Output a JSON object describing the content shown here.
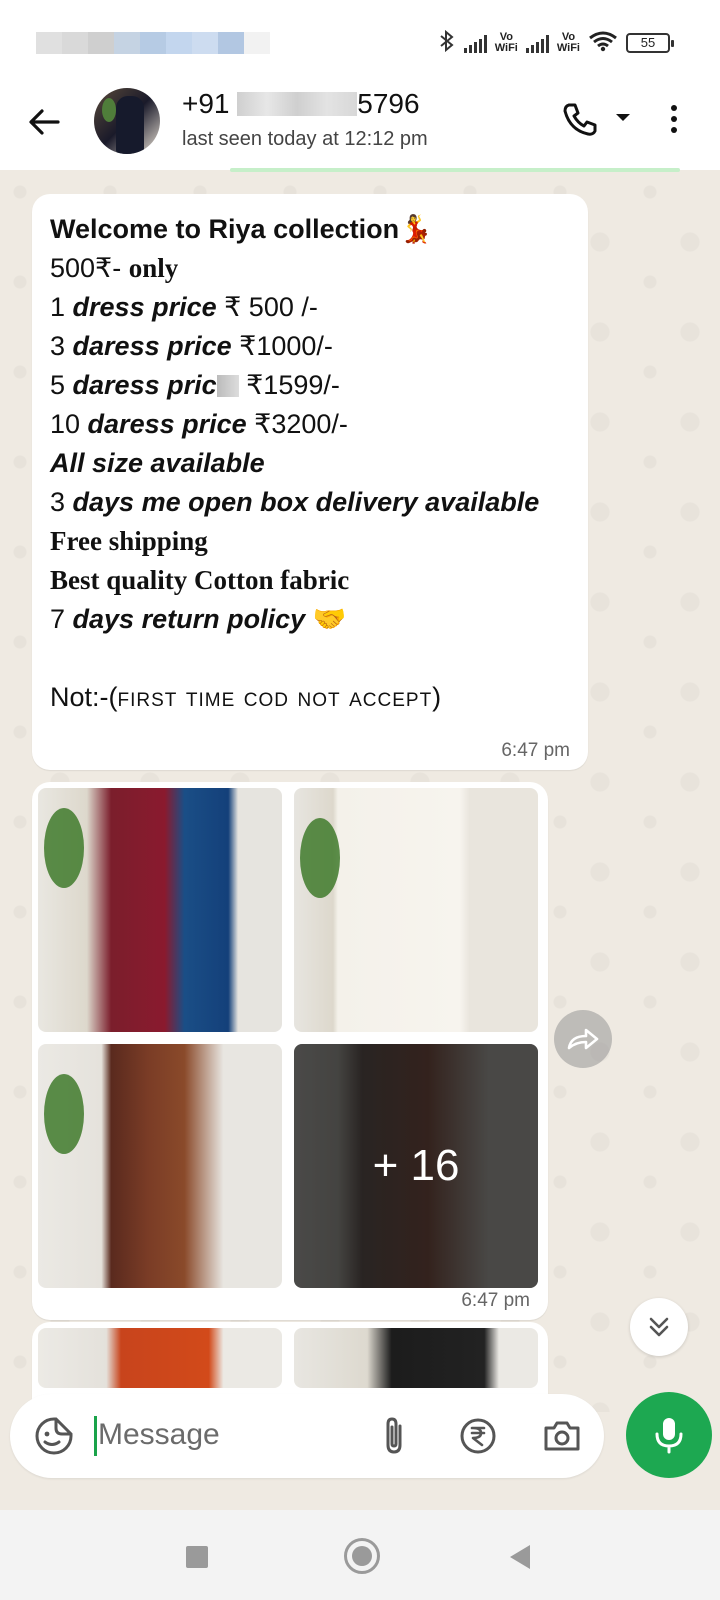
{
  "status_bar": {
    "volte1": "Vo\nWiFi",
    "volte2": "Vo\nWiFi",
    "battery": "55",
    "blur_colors": [
      "#e0e0e0",
      "#d9d9d9",
      "#cfcfcf",
      "#c5d3e3",
      "#b6cbe4",
      "#c3d6ee",
      "#cddcf0",
      "#b2c7e2",
      "#f2f2f2"
    ]
  },
  "header": {
    "name_prefix": "+91",
    "name_suffix": "5796",
    "status": "last seen today at 12:12 pm"
  },
  "message": {
    "lines": [
      {
        "a": "Welcome to Riya collection",
        "emoji": "💃"
      },
      {
        "a": "500₹- ",
        "b": "only"
      },
      {
        "a": "1 ",
        "b": "dress price",
        "c": " ₹ 500 /-"
      },
      {
        "a": "3 ",
        "b": "daress price",
        "c": " ₹1000/-"
      },
      {
        "a": "5 ",
        "b": "daress pric",
        "c": " ₹1599/-"
      },
      {
        "a": "10 ",
        "b": "daress price",
        "c": " ₹3200/-"
      },
      {
        "b": "All size available"
      },
      {
        "a": "3 ",
        "b": "days me open box delivery available"
      },
      {
        "b": "Free shipping"
      },
      {
        "b": "Best quality Cotton fabric"
      },
      {
        "a": "7 ",
        "b": "days return policy",
        "emoji": " 🤝"
      },
      {
        "a": ""
      },
      {
        "a": "Not:-(",
        "b": "first time cod not accept",
        "c": ")"
      }
    ],
    "time": "6:47 pm"
  },
  "media": {
    "more_count": "+ 16",
    "time": "6:47 pm"
  },
  "input": {
    "placeholder": "Message"
  }
}
